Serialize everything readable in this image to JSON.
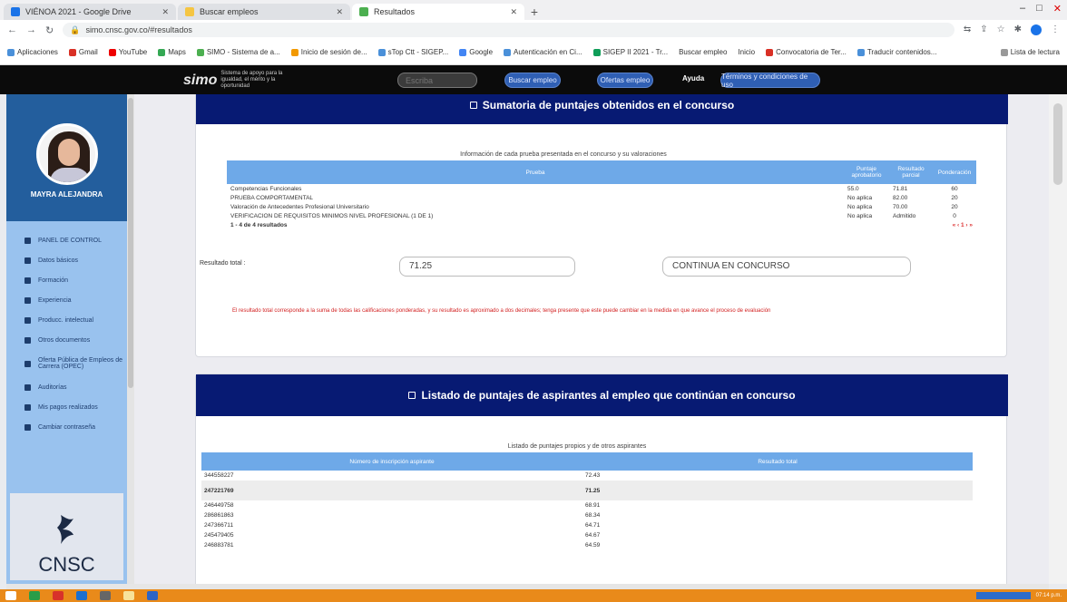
{
  "browser": {
    "tabs": [
      {
        "title": "VIÉNOA 2021 - Google Drive",
        "active": false,
        "favicon_color": "#1a73e8"
      },
      {
        "title": "Buscar empleos",
        "active": false,
        "favicon_color": "#f5c542"
      },
      {
        "title": "Resultados",
        "active": true,
        "favicon_color": "#4caf50"
      }
    ],
    "new_tab": "+",
    "url": "simo.cnsc.gov.co/#resultados",
    "bookmarks": [
      "Aplicaciones",
      "Gmail",
      "YouTube",
      "Maps",
      "SIMO - Sistema de a...",
      "Inicio de sesión de...",
      "sTop Ctt - SIGEP...",
      "Google",
      "Autenticación en Ci...",
      "SIGEP II 2021 - Tr...",
      "Buscar empleo",
      "Inicio",
      "Convocatoria de Ter...",
      "Traducir contenidos..."
    ],
    "bookmarks_end": "Lista de lectura"
  },
  "header": {
    "logo": "simo",
    "logo_tagline": "Sistema de apoyo para la igualdad, el mérito y la oportunidad",
    "search_placeholder": "Escriba",
    "search_button": "Buscar empleo",
    "ofertas_button": "Ofertas empleo",
    "ayuda": "Ayuda",
    "terminos_button": "Términos y condiciones de uso"
  },
  "sidebar": {
    "user_name": "MAYRA ALEJANDRA",
    "items": [
      "PANEL DE CONTROL",
      "Datos básicos",
      "Formación",
      "Experiencia",
      "Producc. intelectual",
      "Otros documentos",
      "Oferta Pública de Empleos de Carrera (OPEC)",
      "Auditorías",
      "Mis pagos realizados",
      "Cambiar contraseña"
    ],
    "brand": "CNSC"
  },
  "section1": {
    "title": "Sumatoria de puntajes obtenidos en el concurso",
    "caption": "Información de cada prueba presentada en el concurso y su valoraciones",
    "headers": [
      "Prueba",
      "Puntaje aprobatorio",
      "Resultado parcial",
      "Ponderación"
    ],
    "rows": [
      [
        "Competencias Funcionales",
        "55.0",
        "71.81",
        "60"
      ],
      [
        "PRUEBA COMPORTAMENTAL",
        "No aplica",
        "82.00",
        "20"
      ],
      [
        "Valoración de Antecedentes Profesional Universitario",
        "No aplica",
        "70.00",
        "20"
      ],
      [
        "VERIFICACION DE REQUISITOS MINIMOS NIVEL PROFESIONAL (1 DE 1)",
        "No aplica",
        "Admitido",
        "0"
      ]
    ],
    "count_text": "1 - 4 de 4 resultados",
    "pager": "« ‹ 1 › »",
    "result_label": "Resultado total :",
    "result_value": "71.25",
    "status_value": "CONTINUA EN CONCURSO",
    "note": "El resultado total corresponde a la suma de todas las calificaciones ponderadas, y su resultado es aproximado a dos decimales; tenga presente que este puede cambiar en la medida en que avance el proceso de evaluación"
  },
  "section2": {
    "title": "Listado de puntajes de aspirantes al empleo que continúan en concurso",
    "caption": "Listado de puntajes propios y de otros aspirantes",
    "headers": [
      "Número de inscripción aspirante",
      "Resultado total"
    ],
    "rows": [
      [
        "344558227",
        "72.43",
        false
      ],
      [
        "247221769",
        "71.25",
        true
      ],
      [
        "246449758",
        "68.91",
        false
      ],
      [
        "286861863",
        "68.34",
        false
      ],
      [
        "247366711",
        "64.71",
        false
      ],
      [
        "245479405",
        "64.67",
        false
      ],
      [
        "246883781",
        "64.59",
        false
      ]
    ]
  },
  "taskbar": {
    "clock": "07:14 p.m."
  },
  "colors": {
    "header_bg": "#071a73",
    "table_header": "#6ea9e8",
    "sidebar_top": "#235e9d",
    "sidebar_bg": "#99c2ee",
    "note_red": "#d21f1f",
    "taskbar": "#e98a1a"
  }
}
